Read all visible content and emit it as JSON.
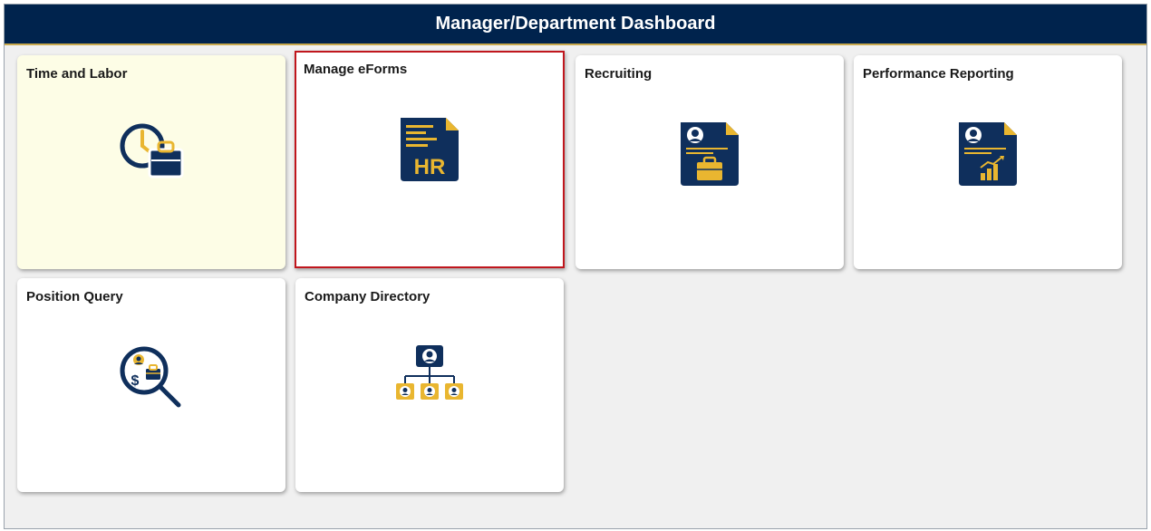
{
  "header": {
    "title": "Manager/Department Dashboard"
  },
  "tiles": [
    {
      "label": "Time and Labor",
      "icon": "clock-briefcase-icon"
    },
    {
      "label": "Manage eForms",
      "icon": "hr-document-icon"
    },
    {
      "label": "Recruiting",
      "icon": "recruiting-document-icon"
    },
    {
      "label": "Performance Reporting",
      "icon": "performance-report-icon"
    },
    {
      "label": "Position Query",
      "icon": "position-search-icon"
    },
    {
      "label": "Company Directory",
      "icon": "org-chart-icon"
    }
  ],
  "colors": {
    "navy": "#0f2f5c",
    "gold": "#e9b630",
    "banner": "#00234d",
    "selected_border": "#c0161d",
    "highlight_tile": "#fdfde6"
  }
}
